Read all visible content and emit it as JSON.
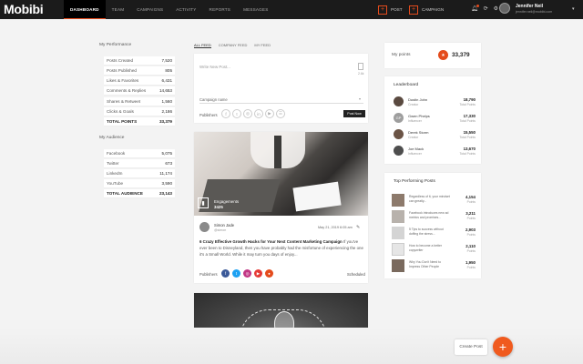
{
  "topbar": {
    "logo": "Mobibi",
    "nav": [
      "DASHBOARD",
      "TEAM",
      "CAMPAIGNS",
      "ACTIVITY",
      "REPORTS",
      "MESSAGES"
    ],
    "post_btn": "POST",
    "campaign_btn": "CAMPAIGN",
    "user_name": "Jennifer Neil",
    "user_email": "jennifer.neil@mobibi.com",
    "accent": "#e44b1c"
  },
  "performance": {
    "title": "My Performance",
    "rows": [
      {
        "label": "Posts Created",
        "value": "7,520"
      },
      {
        "label": "Posts Published",
        "value": "805"
      },
      {
        "label": "Likes & Favorites",
        "value": "6,431"
      },
      {
        "label": "Comments & Replies",
        "value": "14,653"
      },
      {
        "label": "Shares & Retweet",
        "value": "1,560"
      },
      {
        "label": "Clicks & Goals",
        "value": "2,186"
      }
    ],
    "total_label": "TOTAL POINTS",
    "total_value": "33,379"
  },
  "audience": {
    "title": "My Audience",
    "rows": [
      {
        "label": "Facebook",
        "value": "5,075"
      },
      {
        "label": "Twitter",
        "value": "673"
      },
      {
        "label": "LinkedIn",
        "value": "11,174"
      },
      {
        "label": "YouTube",
        "value": "3,590"
      }
    ],
    "total_label": "TOTAL AUDIENCE",
    "total_value": "23,143"
  },
  "feed_tabs": [
    "ALL FEED",
    "COMPANY FEED",
    "MY FEED"
  ],
  "compose": {
    "placeholder": "Write New Post...",
    "char_count": "2.6k",
    "campaign_label": "Campaign name",
    "publishers_label": "Publishers",
    "post_now": "Post Now"
  },
  "post": {
    "engagements_label": "Engagements",
    "engagements_value": "3425",
    "author": "Simon Jade",
    "handle": "@simon",
    "date": "May 21, 2019 6:05 am",
    "title": "6 Crazy Effective Growth Hacks for Your Next Content Marketing Campaign",
    "body": "If you've ever been to Disneyland, then you have probably had the misfortune of experiencing the one it's a Small World. While it may turn you days of enjoy...",
    "publishers_label": "Publishers",
    "status": "Scheduled"
  },
  "points": {
    "label": "My points",
    "value": "33,379"
  },
  "leaderboard": {
    "title": "Leaderboard",
    "rows": [
      {
        "name": "Dustin John",
        "role": "Creator",
        "points": "18,790",
        "points_label": "Total Points",
        "initials": ""
      },
      {
        "name": "Gwen Phelps",
        "role": "Influencer",
        "points": "17,330",
        "points_label": "Total Points",
        "initials": "GP"
      },
      {
        "name": "Derek Storm",
        "role": "Creator",
        "points": "15,550",
        "points_label": "Total Points",
        "initials": ""
      },
      {
        "name": "Joe Mack",
        "role": "Influencer",
        "points": "13,670",
        "points_label": "Total Points",
        "initials": ""
      }
    ]
  },
  "top_posts": {
    "title": "Top Performing Posts",
    "rows": [
      {
        "text": "Regardless of it, your mindset can greatly...",
        "value": "4,154",
        "label": "Points"
      },
      {
        "text": "Facebook introduces new ad metrics and promises...",
        "value": "3,211",
        "label": "Points"
      },
      {
        "text": "5 Tips to success without doffing the stress...",
        "value": "2,903",
        "label": "Points"
      },
      {
        "text": "How to become a better copywriter",
        "value": "2,110",
        "label": "Points"
      },
      {
        "text": "Why You Don't Need to Impress Other People",
        "value": "1,950",
        "label": "Points"
      }
    ]
  },
  "create_post": "Create Post"
}
